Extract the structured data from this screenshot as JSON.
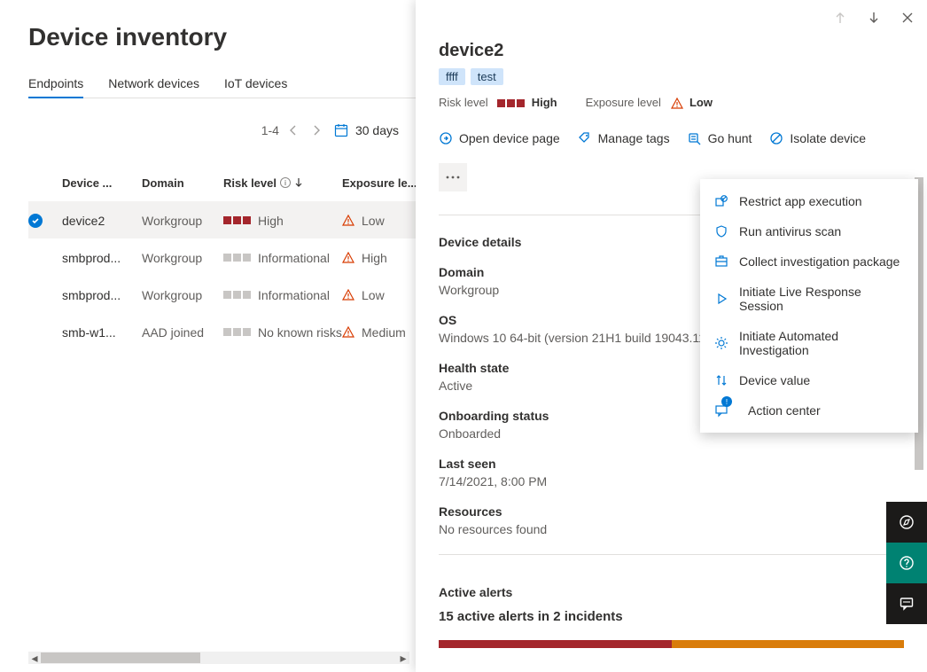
{
  "page_title": "Device inventory",
  "tabs": [
    "Endpoints",
    "Network devices",
    "IoT devices"
  ],
  "filterbar": {
    "range": "1-4",
    "date_filter": "30 days"
  },
  "columns": {
    "device": "Device ...",
    "domain": "Domain",
    "risk": "Risk level",
    "exposure": "Exposure le..."
  },
  "rows": [
    {
      "selected": true,
      "device": "device2",
      "domain": "Workgroup",
      "risk_level": "High",
      "risk_style": "high",
      "exposure": "Low"
    },
    {
      "selected": false,
      "device": "smbprod...",
      "domain": "Workgroup",
      "risk_level": "Informational",
      "risk_style": "info",
      "exposure": "High"
    },
    {
      "selected": false,
      "device": "smbprod...",
      "domain": "Workgroup",
      "risk_level": "Informational",
      "risk_style": "info",
      "exposure": "Low"
    },
    {
      "selected": false,
      "device": "smb-w1...",
      "domain": "AAD joined",
      "risk_level": "No known risks..",
      "risk_style": "info",
      "exposure": "Medium"
    }
  ],
  "panel": {
    "title": "device2",
    "tags": [
      "ffff",
      "test"
    ],
    "risk_label": "Risk level",
    "risk_value": "High",
    "exposure_label": "Exposure level",
    "exposure_value": "Low",
    "actions": {
      "open": "Open device page",
      "tags": "Manage tags",
      "hunt": "Go hunt",
      "isolate": "Isolate device"
    },
    "details_heading": "Device details",
    "details": {
      "domain_k": "Domain",
      "domain_v": "Workgroup",
      "os_k": "OS",
      "os_v": "Windows 10 64-bit (version 21H1 build 19043.1110)",
      "health_k": "Health state",
      "health_v": "Active",
      "onboard_k": "Onboarding status",
      "onboard_v": "Onboarded",
      "lastseen_k": "Last seen",
      "lastseen_v": "7/14/2021, 8:00 PM",
      "resources_k": "Resources",
      "resources_v": "No resources found"
    },
    "alerts": {
      "heading": "Active alerts",
      "summary": "15 active alerts in 2 incidents"
    }
  },
  "menu": {
    "restrict": "Restrict app execution",
    "av": "Run antivirus scan",
    "collect": "Collect investigation package",
    "live": "Initiate Live Response Session",
    "auto": "Initiate Automated Investigation",
    "value": "Device value",
    "action_center": "Action center"
  }
}
